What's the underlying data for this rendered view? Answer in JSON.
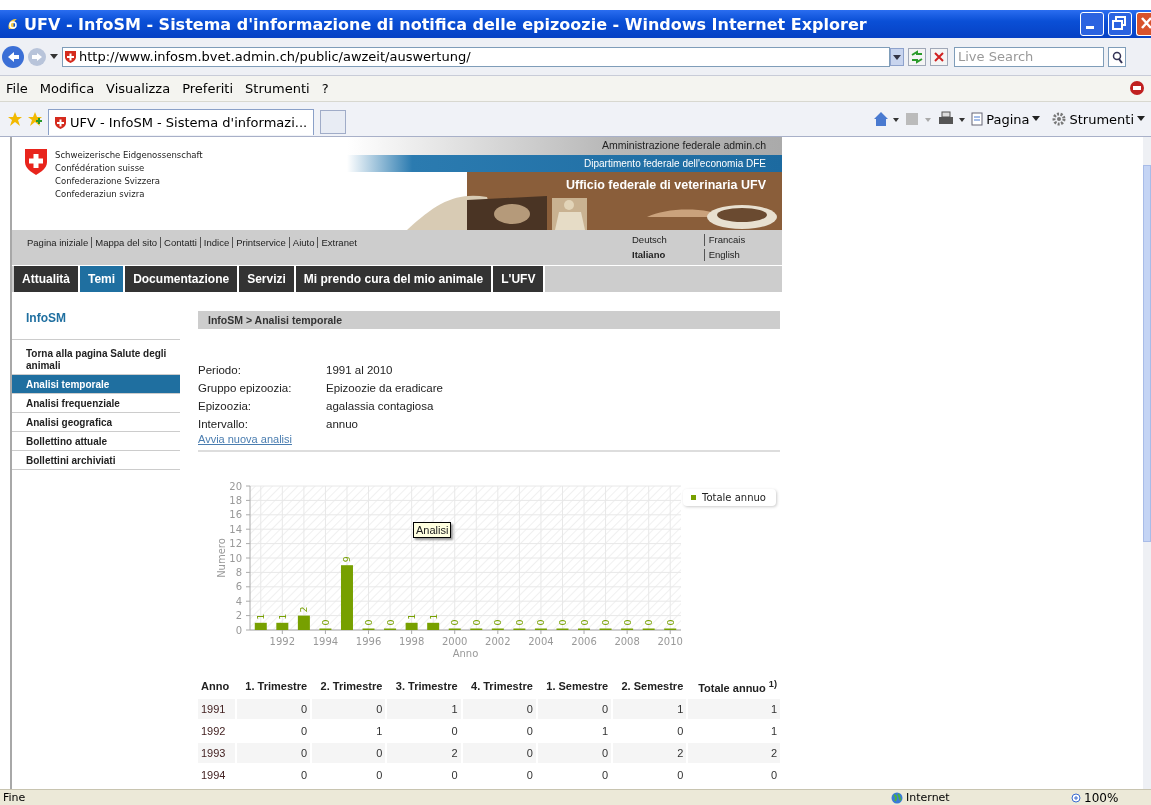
{
  "window": {
    "title": "UFV - InfoSM - Sistema d'informazione di notifica delle epizoozie - Windows Internet Explorer"
  },
  "address_bar": {
    "url": "http://www.infosm.bvet.admin.ch/public/awzeit/auswertung/"
  },
  "search": {
    "placeholder": "Live Search"
  },
  "menu": [
    "File",
    "Modifica",
    "Visualizza",
    "Preferiti",
    "Strumenti",
    "?"
  ],
  "tabs": [
    {
      "label": "UFV - InfoSM - Sistema d'informazi...",
      "selected": true
    }
  ],
  "command_bar": [
    "Pagina",
    "Strumenti"
  ],
  "site": {
    "federation": [
      "Schweizerische Eidgenossenschaft",
      "Confédération suisse",
      "Confederazione Svizzera",
      "Confederaziun svizra"
    ],
    "admin_link": "Amministrazione federale admin.ch",
    "department": "Dipartimento federale dell'economia DFE",
    "office": "Ufficio federale di veterinaria UFV",
    "service_links": [
      "Pagina iniziale",
      "Mappa del sito",
      "Contatti",
      "Indice",
      "Printservice",
      "Aiuto",
      "Extranet"
    ],
    "languages": [
      {
        "label": "Deutsch",
        "selected": false
      },
      {
        "label": "Francais",
        "selected": false
      },
      {
        "label": "Italiano",
        "selected": true
      },
      {
        "label": "English",
        "selected": false
      }
    ],
    "nav": [
      {
        "label": "Attualità",
        "selected": false
      },
      {
        "label": "Temi",
        "selected": true
      },
      {
        "label": "Documentazione",
        "selected": false
      },
      {
        "label": "Servizi",
        "selected": false
      },
      {
        "label": "Mi prendo cura del mio animale",
        "selected": false
      },
      {
        "label": "L'UFV",
        "selected": false
      }
    ],
    "sidebar": {
      "title": "InfoSM",
      "items": [
        {
          "label": "Torna alla pagina Salute degli animali",
          "selected": false
        },
        {
          "label": "Analisi temporale",
          "selected": true
        },
        {
          "label": "Analisi frequenziale",
          "selected": false
        },
        {
          "label": "Analisi geografica",
          "selected": false
        },
        {
          "label": "Bollettino attuale",
          "selected": false
        },
        {
          "label": "Bollettini archiviati",
          "selected": false
        }
      ]
    },
    "breadcrumb": "InfoSM > Analisi temporale",
    "fields": [
      {
        "label": "Periodo:",
        "value": "1991 al 2010"
      },
      {
        "label": "Gruppo epizoozia:",
        "value": "Epizoozie da eradicare"
      },
      {
        "label": "Epizoozia:",
        "value": "agalassia contagiosa"
      },
      {
        "label": "Intervallo:",
        "value": "annuo"
      }
    ],
    "new_analysis_link": "Avvia nuova analisi",
    "chart": {
      "tooltip": "Analisi",
      "chart_data": {
        "type": "bar",
        "xlabel": "Anno",
        "ylabel": "Numero",
        "x": [
          1991,
          1992,
          1993,
          1994,
          1995,
          1996,
          1997,
          1998,
          1999,
          2000,
          2001,
          2002,
          2003,
          2004,
          2005,
          2006,
          2007,
          2008,
          2009,
          2010
        ],
        "series": [
          {
            "name": "Totale annuo",
            "color": "#77a000",
            "values": [
              1,
              1,
              2,
              0,
              9,
              0,
              0,
              1,
              1,
              0,
              0,
              0,
              0,
              0,
              0,
              0,
              0,
              0,
              0,
              0
            ]
          }
        ],
        "xlim": [
          1990.5,
          2010.5
        ],
        "ylim": [
          0,
          20
        ],
        "grid": true,
        "yticks": [
          0,
          2,
          4,
          6,
          8,
          10,
          12,
          14,
          16,
          18,
          20
        ],
        "xticks": [
          1992,
          1994,
          1996,
          1998,
          2000,
          2002,
          2004,
          2006,
          2008,
          2010
        ],
        "data_labels": true
      }
    },
    "table": {
      "columns": [
        "Anno",
        "1. Trimestre",
        "2. Trimestre",
        "3. Trimestre",
        "4. Trimestre",
        "1. Semestre",
        "2. Semestre",
        "Totale annuo $^{1)}$"
      ],
      "rows": [
        [
          "1991",
          "0",
          "0",
          "1",
          "0",
          "0",
          "1",
          "1"
        ],
        [
          "1992",
          "0",
          "1",
          "0",
          "0",
          "1",
          "0",
          "1"
        ],
        [
          "1993",
          "0",
          "0",
          "2",
          "0",
          "0",
          "2",
          "2"
        ],
        [
          "1994",
          "0",
          "0",
          "0",
          "0",
          "0",
          "0",
          "0"
        ]
      ]
    }
  },
  "status_bar": {
    "text": "Fine",
    "zone": "Internet",
    "zoom": "100%"
  }
}
